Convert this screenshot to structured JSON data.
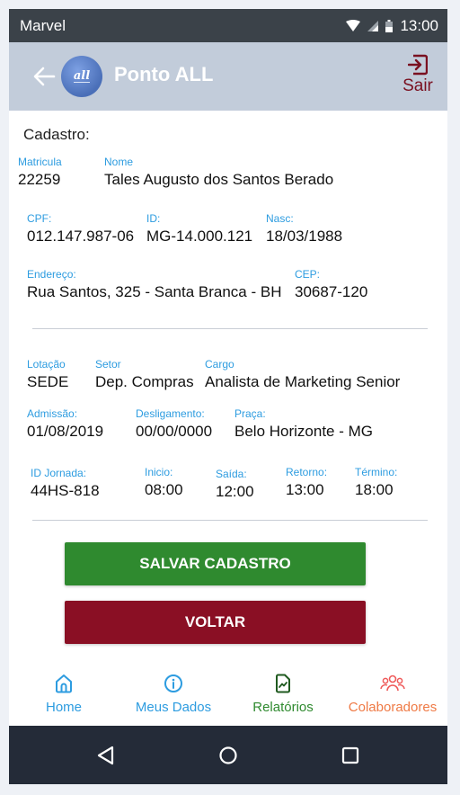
{
  "status_bar": {
    "carrier": "Marvel",
    "time": "13:00"
  },
  "app_bar": {
    "title": "Ponto ALL",
    "logo_text": "all",
    "logout_label": "Sair"
  },
  "section_title": "Cadastro:",
  "fields": {
    "matricula": {
      "label": "Matricula",
      "value": "22259"
    },
    "nome": {
      "label": "Nome",
      "value": "Tales Augusto dos Santos Berado"
    },
    "cpf": {
      "label": "CPF:",
      "value": "012.147.987-06"
    },
    "id": {
      "label": "ID:",
      "value": "MG-14.000.121"
    },
    "nasc": {
      "label": "Nasc:",
      "value": "18/03/1988"
    },
    "endereco": {
      "label": "Endereço:",
      "value": "Rua Santos, 325 - Santa Branca - BH"
    },
    "cep": {
      "label": "CEP:",
      "value": "30687-120"
    },
    "lotacao": {
      "label": "Lotação",
      "value": "SEDE"
    },
    "setor": {
      "label": "Setor",
      "value": "Dep. Compras"
    },
    "cargo": {
      "label": "Cargo",
      "value": "Analista de Marketing Senior"
    },
    "admissao": {
      "label": "Admissão:",
      "value": "01/08/2019"
    },
    "desligamento": {
      "label": "Desligamento:",
      "value": "00/00/0000"
    },
    "praca": {
      "label": "Praça:",
      "value": "Belo Horizonte - MG"
    },
    "id_jornada": {
      "label": "ID Jornada:",
      "value": "44HS-818"
    },
    "inicio": {
      "label": "Inicio:",
      "value": "08:00"
    },
    "saida": {
      "label": "Saída:",
      "value": "12:00"
    },
    "retorno": {
      "label": "Retorno:",
      "value": "13:00"
    },
    "termino": {
      "label": "Término:",
      "value": "18:00"
    }
  },
  "buttons": {
    "save": "SALVAR CADASTRO",
    "back": "VOLTAR"
  },
  "bottom_nav": [
    {
      "label": "Home",
      "icon": "home-icon",
      "color": "#2d9ce0"
    },
    {
      "label": "Meus Dados",
      "icon": "info-icon",
      "color": "#2d9ce0"
    },
    {
      "label": "Relatórios",
      "icon": "report-icon",
      "color": "#2f8a2f"
    },
    {
      "label": "Colaboradores",
      "icon": "users-icon",
      "color": "#ef7a45"
    }
  ],
  "colors": {
    "app_bar": "#c2ccda",
    "label_blue": "#2d9ce0",
    "save_green": "#2f8a2f",
    "back_red": "#8a0f24",
    "status_bar": "#3b4249",
    "system_nav": "#242b38"
  }
}
